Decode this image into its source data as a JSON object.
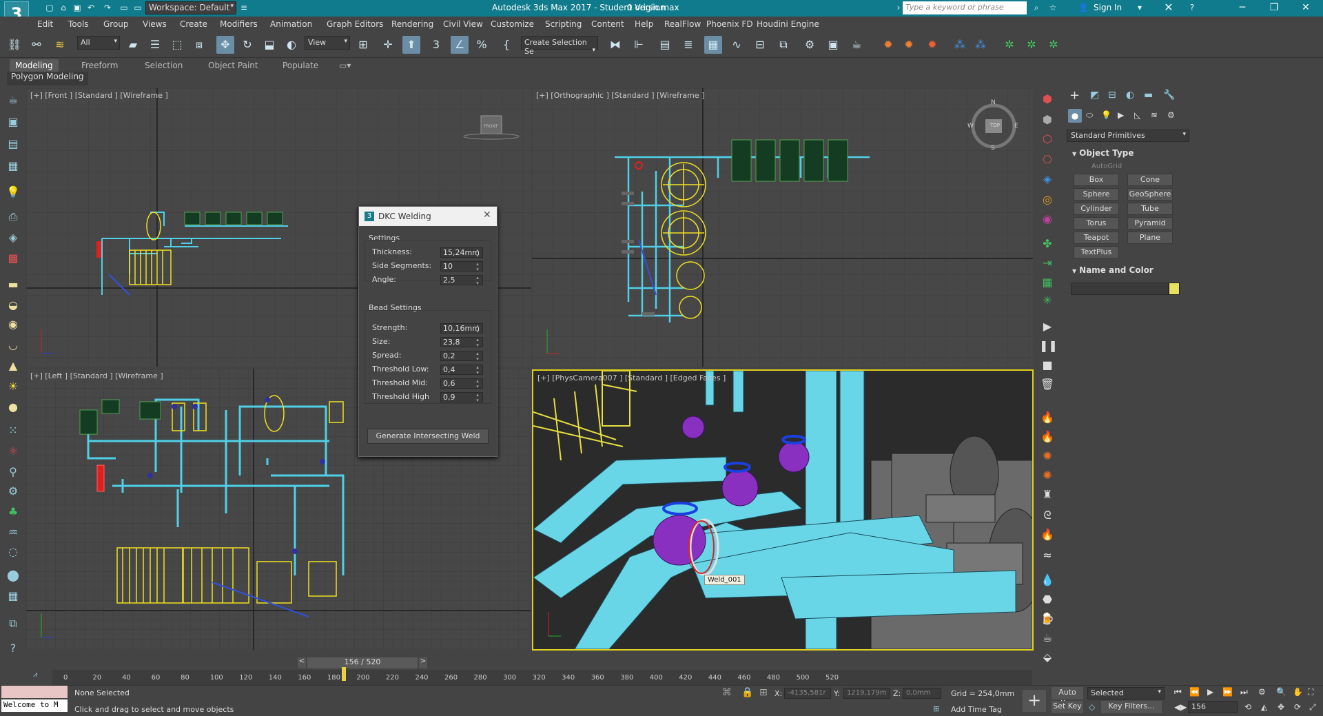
{
  "titlebar": {
    "app_title": "Autodesk 3ds Max 2017 - Student Version",
    "file_name": "0 origin.max",
    "workspace_label": "Workspace: Default",
    "search_placeholder": "Type a keyword or phrase",
    "sign_in": "Sign In",
    "logo": "3",
    "accent": "#0f7b8c"
  },
  "menu": [
    "Edit",
    "Tools",
    "Group",
    "Views",
    "Create",
    "Modifiers",
    "Animation",
    "Graph Editors",
    "Rendering",
    "Civil View",
    "Customize",
    "Scripting",
    "Content",
    "Help",
    "RealFlow",
    "Phoenix FD",
    "Houdini Engine"
  ],
  "toolbar": {
    "filter_value": "All",
    "refcoord_value": "View",
    "selection_set_value": "Create Selection Se"
  },
  "ribbon": {
    "tabs": [
      "Modeling",
      "Freeform",
      "Selection",
      "Object Paint",
      "Populate"
    ],
    "sub_label": "Polygon Modeling"
  },
  "viewports": {
    "front": "[+] [Front ] [Standard ] [Wireframe ]",
    "ortho": "[+] [Orthographic ] [Standard ] [Wireframe ]",
    "left": "[+] [Left ] [Standard ] [Wireframe ]",
    "camera": "[+] [PhysCamera007 ] [Standard ] [Edged Faces ]",
    "viewcube_front": "FRONT",
    "viewcube_top": "TOP",
    "compass": {
      "n": "N",
      "s": "S",
      "e": "E",
      "w": "W"
    },
    "weld_tooltip": "Weld_001"
  },
  "dialog": {
    "title": "DKC Welding",
    "settings_header": "Settings",
    "settings": [
      {
        "label": "Thickness:",
        "value": "15,24mm"
      },
      {
        "label": "Side Segments:",
        "value": "10"
      },
      {
        "label": "Angle:",
        "value": "2,5"
      }
    ],
    "bead_header": "Bead Settings",
    "bead": [
      {
        "label": "Strength:",
        "value": "10,16mm"
      },
      {
        "label": "Size:",
        "value": "23,8"
      },
      {
        "label": "Spread:",
        "value": "0,2"
      },
      {
        "label": "Threshold Low:",
        "value": "0,4"
      },
      {
        "label": "Threshold Mid:",
        "value": "0,6"
      },
      {
        "label": "Threshold High",
        "value": "0,9"
      }
    ],
    "button": "Generate Intersecting Weld"
  },
  "command_panel": {
    "category": "Standard Primitives",
    "object_type_header": "Object Type",
    "autogrid": "AutoGrid",
    "buttons": [
      "Box",
      "Cone",
      "Sphere",
      "GeoSphere",
      "Cylinder",
      "Tube",
      "Torus",
      "Pyramid",
      "Teapot",
      "Plane",
      "TextPlus"
    ],
    "name_color_header": "Name and Color",
    "name_value": "",
    "color_swatch": "#e8e060"
  },
  "timeline": {
    "frame_display": "156 / 520",
    "ticks": [
      "0",
      "20",
      "40",
      "60",
      "80",
      "100",
      "120",
      "140",
      "160",
      "180",
      "200",
      "220",
      "240",
      "260",
      "280",
      "300",
      "320",
      "340",
      "360",
      "380",
      "400",
      "420",
      "440",
      "460",
      "480",
      "500",
      "520"
    ]
  },
  "status": {
    "maxscript": "Welcome to M",
    "selection": "None Selected",
    "prompt": "Click and drag to select and move objects",
    "x_label": "X:",
    "x_value": "-4135,581r",
    "y_label": "Y:",
    "y_value": "1219,179m",
    "z_label": "Z:",
    "z_value": "0,0mm",
    "grid": "Grid = 254,0mm",
    "add_time_tag": "Add Time Tag",
    "auto_key": "Auto Key",
    "set_key": "Set Key",
    "key_mode": "Selected",
    "key_filters": "Key Filters...",
    "current_frame": "156"
  }
}
